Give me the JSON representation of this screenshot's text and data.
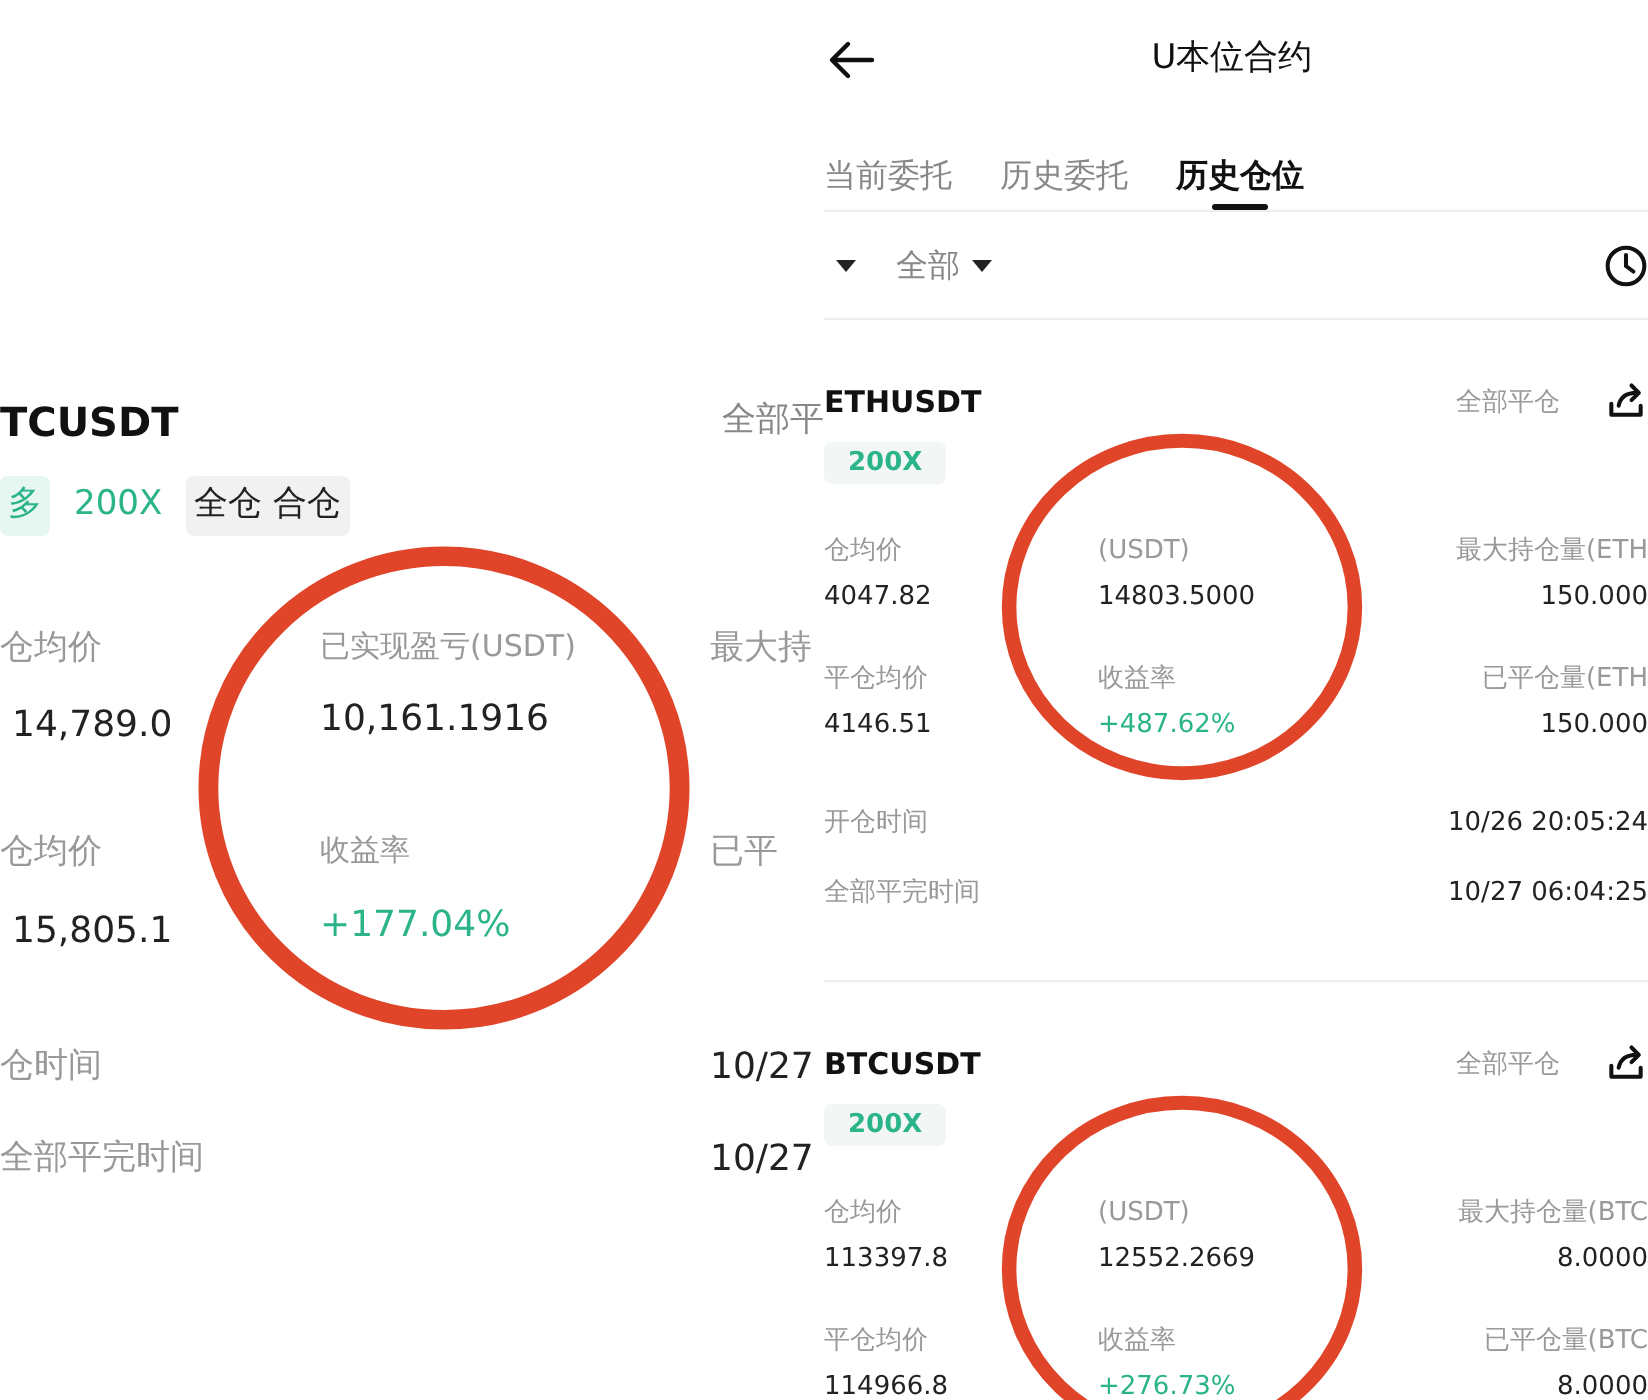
{
  "left_panel": {
    "symbol": "TCUSDT",
    "close_all": "全部平",
    "circled": true,
    "tags": [
      {
        "label": "多",
        "kind": "side"
      },
      {
        "label": "200X",
        "kind": "leverage"
      },
      {
        "label": "全仓 合仓",
        "kind": "mode"
      }
    ],
    "metric_rows": [
      [
        {
          "label": "仓均价",
          "value": "14,789.0"
        },
        {
          "label": "已实现盈亏(USDT)",
          "value": "10,161.1916"
        },
        {
          "label": "最大持"
        }
      ],
      [
        {
          "label": "仓均价",
          "value": "15,805.1"
        },
        {
          "label": "收益率",
          "value": "+177.04%",
          "color": "#2bb38a"
        },
        {
          "label": "已平"
        }
      ]
    ],
    "time_rows": [
      {
        "label": "仓时间",
        "value": "10/27"
      },
      {
        "label": "全部平完时间",
        "value": "10/27"
      }
    ]
  },
  "right_panel": {
    "title": "U本位合约",
    "tabs": [
      {
        "label": "当前委托",
        "selected": false
      },
      {
        "label": "历史委托",
        "selected": false
      },
      {
        "label": "历史仓位",
        "selected": true
      }
    ],
    "filters": [
      {
        "kind": "caret"
      },
      {
        "kind": "dropdown",
        "label": "全部"
      }
    ],
    "cards": [
      {
        "symbol": "ETHUSDT",
        "tag": "200X",
        "close_all": "全部平仓",
        "circled": true,
        "metric_rows": [
          [
            {
              "label": "仓均价",
              "value": "4047.82"
            },
            {
              "label": "(USDT)",
              "value": "14803.5000"
            },
            {
              "label": "最大持仓量(ETH",
              "value": "150.000"
            }
          ],
          [
            {
              "label": "平仓均价",
              "value": "4146.51"
            },
            {
              "label": "收益率",
              "value": "+487.62%",
              "color": "#2bb38a"
            },
            {
              "label": "已平仓量(ETH",
              "value": "150.000"
            }
          ]
        ],
        "time_rows": [
          {
            "label": "开仓时间",
            "value": "10/26 20:05:24"
          },
          {
            "label": "全部平完时间",
            "value": "10/27 06:04:25"
          }
        ]
      },
      {
        "symbol": "BTCUSDT",
        "tag": "200X",
        "close_all": "全部平仓",
        "circled": true,
        "metric_rows": [
          [
            {
              "label": "仓均价",
              "value": "113397.8"
            },
            {
              "label": "(USDT)",
              "value": "12552.2669"
            },
            {
              "label": "最大持仓量(BTC",
              "value": "8.0000"
            }
          ],
          [
            {
              "label": "平仓均价",
              "value": "114966.8"
            },
            {
              "label": "收益率",
              "value": "+276.73%",
              "color": "#2bb38a"
            },
            {
              "label": "已平仓量(BTC",
              "value": "8.0000"
            }
          ]
        ]
      }
    ]
  }
}
